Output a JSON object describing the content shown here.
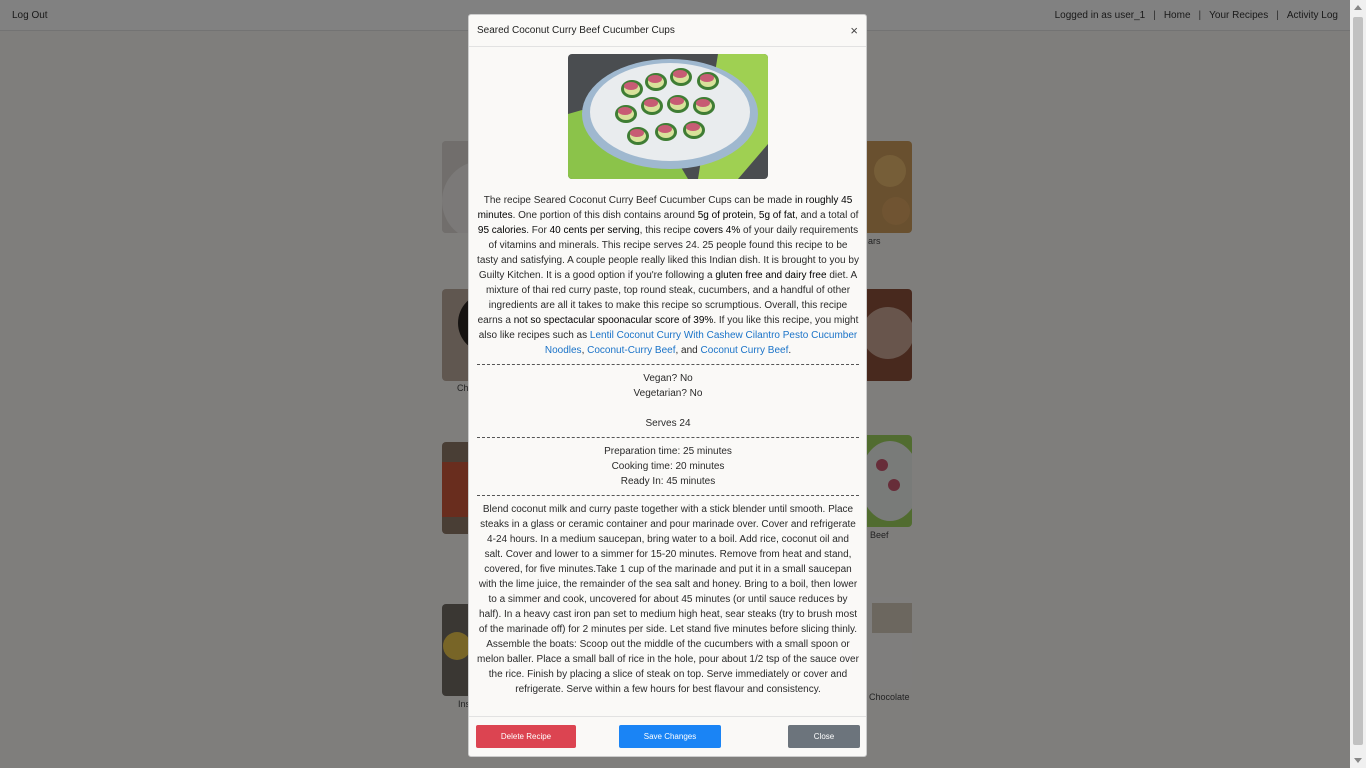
{
  "topbar": {
    "logout": "Log Out",
    "logged_in": "Logged in as user_1",
    "sep": "|",
    "home": "Home",
    "your_recipes": "Your Recipes",
    "activity_log": "Activity Log"
  },
  "background_labels": {
    "l1": "Ch",
    "l2": "ars",
    "l3": "Beef",
    "l4": "Ins",
    "l5": "Chocolate"
  },
  "modal": {
    "title": "Seared Coconut Curry Beef Cucumber Cups",
    "close_symbol": "×",
    "description": {
      "t1": "The recipe Seared Coconut Curry Beef Cucumber Cups can be made ",
      "b1": "in roughly 45 minutes",
      "t2": ". One portion of this dish contains around ",
      "b2": "5g of protein",
      "t3": ", ",
      "b3": "5g of fat",
      "t4": ", and a total of ",
      "b4": "95 calories",
      "t5": ". For ",
      "b5": "40 cents per serving",
      "t6": ", this recipe ",
      "b6": "covers 4%",
      "t7": " of your daily requirements of vitamins and minerals. This recipe serves 24. 25 people found this recipe to be tasty and satisfying. A couple people really liked this Indian dish. It is brought to you by Guilty Kitchen. It is a good option if you're following a ",
      "b7": "gluten free and dairy free",
      "t8": " diet. A mixture of thai red curry paste, top round steak, cucumbers, and a handful of other ingredients are all it takes to make this recipe so scrumptious. Overall, this recipe earns a ",
      "b8": "not so spectacular spoonacular score of 39%",
      "t9": ". If you like this recipe, you might also like recipes such as ",
      "link1": "Lentil Coconut Curry With Cashew Cilantro Pesto Cucumber Noodles",
      "t10": ", ",
      "link2": "Coconut-Curry Beef",
      "t11": ", and ",
      "link3": "Coconut Curry Beef",
      "t12": "."
    },
    "vegan": "Vegan? No",
    "vegetarian": "Vegetarian? No",
    "serves": "Serves 24",
    "prep_time": "Preparation time: 25 minutes",
    "cook_time": "Cooking time: 20 minutes",
    "ready_in": "Ready In: 45 minutes",
    "instructions": "Blend coconut milk and curry paste together with a stick blender until smooth. Place steaks in a glass or ceramic container and pour marinade over. Cover and refrigerate 4-24 hours. In a medium saucepan, bring water to a boil. Add rice, coconut oil and salt. Cover and lower to a simmer for 15-20 minutes. Remove from heat and stand, covered, for five minutes.Take 1 cup of the marinade and put it in a small saucepan with the lime juice, the remainder of the sea salt and honey. Bring to a boil, then lower to a simmer and cook, uncovered for about 45 minutes (or until sauce reduces by half). In a heavy cast iron pan set to medium high heat, sear steaks (try to brush most of the marinade off) for 2 minutes per side. Let stand five minutes before slicing thinly. Assemble the boats: Scoop out the middle of the cucumbers with a small spoon or melon baller. Place a small ball of rice in the hole, pour about 1/2 tsp of the sauce over the rice. Finish by placing a slice of steak on top. Serve immediately or cover and refrigerate. Serve within a few hours for best flavour and consistency.",
    "buttons": {
      "delete": "Delete Recipe",
      "save": "Save Changes",
      "close": "Close"
    }
  },
  "colors": {
    "delete": "#dc4451",
    "save": "#1a84f5",
    "close": "#6c747c",
    "link": "#1a73c8"
  }
}
